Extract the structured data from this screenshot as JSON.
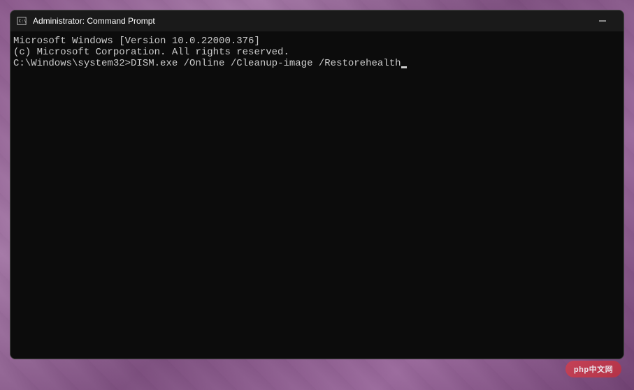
{
  "window": {
    "title": "Administrator: Command Prompt"
  },
  "terminal": {
    "line1": "Microsoft Windows [Version 10.0.22000.376]",
    "line2": "(c) Microsoft Corporation. All rights reserved.",
    "blank": "",
    "prompt": "C:\\Windows\\system32>",
    "command": "DISM.exe /Online /Cleanup-image /Restorehealth"
  },
  "watermark": {
    "text": "php中文网"
  }
}
